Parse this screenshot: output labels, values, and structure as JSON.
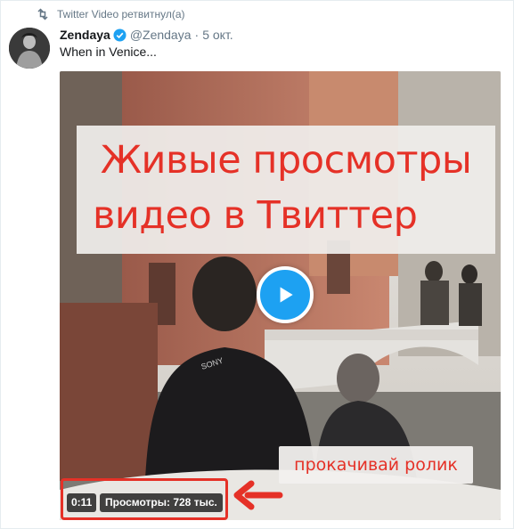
{
  "retweet": {
    "icon": "retweet-icon",
    "text": "Twitter Video ретвитнул(а)"
  },
  "tweet": {
    "display_name": "Zendaya",
    "verified_icon": "verified-icon",
    "handle": "@Zendaya",
    "separator": "·",
    "timestamp": "5 окт.",
    "text": "When in Venice..."
  },
  "media": {
    "play_icon": "play-icon",
    "duration": "0:11",
    "views": "Просмотры: 728 тыс."
  },
  "overlay": {
    "banner_line1": "Живые просмотры",
    "banner_line2": "видео в Твиттер",
    "callout": "прокачивай ролик",
    "accent_color": "#e53127"
  },
  "colors": {
    "twitter_blue": "#1da1f2",
    "muted": "#657786",
    "text": "#14171a"
  }
}
